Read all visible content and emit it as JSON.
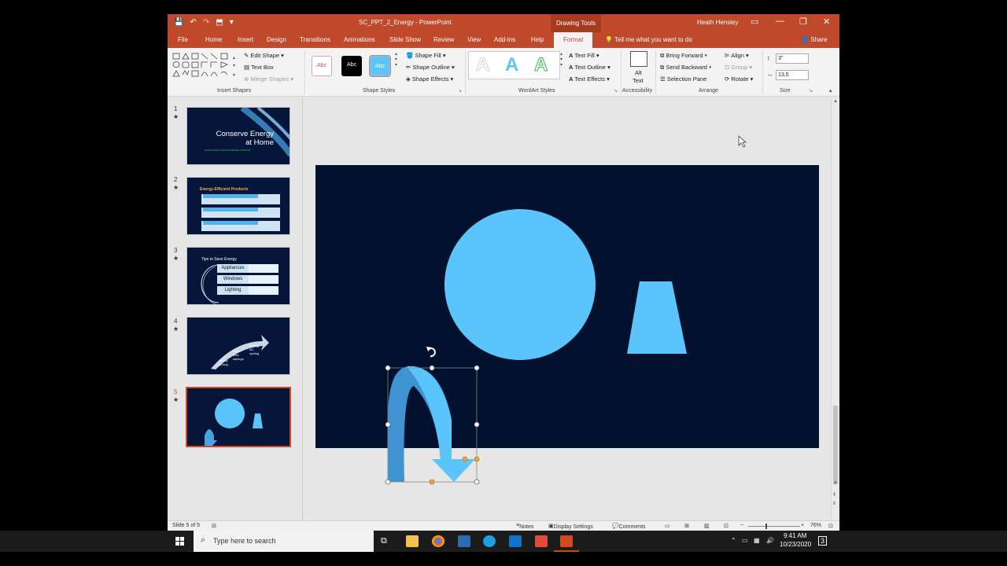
{
  "titlebar": {
    "doc_title": "SC_PPT_2_Energy  -  PowerPoint",
    "context_tab": "Drawing Tools",
    "user": "Heath Hensley",
    "qat": [
      "💾",
      "↶",
      "↷",
      "⬒",
      "▾"
    ],
    "window_buttons": [
      "▭",
      "—",
      "❐",
      "✕"
    ]
  },
  "tabs": {
    "items": [
      "File",
      "Home",
      "Insert",
      "Design",
      "Transitions",
      "Animations",
      "Slide Show",
      "Review",
      "View",
      "Add-ins",
      "Help"
    ],
    "active": "Format",
    "tell_me": "Tell me what you want to do",
    "share": "Share"
  },
  "ribbon": {
    "insert_shapes": {
      "label": "Insert Shapes",
      "edit_shape": "Edit Shape",
      "text_box": "Text Box",
      "merge_shapes": "Merge Shapes"
    },
    "shape_styles": {
      "label": "Shape Styles",
      "swatch_text": "Abc",
      "fill": "Shape Fill",
      "outline": "Shape Outline",
      "effects": "Shape Effects"
    },
    "wordart": {
      "label": "WordArt Styles",
      "letter": "A",
      "text_fill": "Text Fill",
      "text_outline": "Text Outline",
      "text_effects": "Text Effects"
    },
    "accessibility": {
      "label": "Accessibility",
      "alt_text_1": "Alt",
      "alt_text_2": "Text"
    },
    "arrange": {
      "label": "Arrange",
      "bring_forward": "Bring Forward",
      "send_backward": "Send Backward",
      "selection_pane": "Selection Pane",
      "align": "Align",
      "group": "Group",
      "rotate": "Rotate"
    },
    "size": {
      "label": "Size",
      "height": "3\"",
      "width": "13.5"
    }
  },
  "slides": {
    "numbers": [
      "1",
      "2",
      "3",
      "4",
      "5"
    ],
    "star": "★",
    "s1_title_1": "Conserve Energy",
    "s1_title_2": "at Home",
    "s1_subtitle": "SAVE MONEY AND INCREASE COMFORT",
    "s2_title": "Energy-Efficient Products",
    "s3_title": "Tips to Save Energy",
    "s3_items": [
      "Appliances",
      "Windows",
      "Lighting"
    ],
    "s4_labels": [
      "Hourly pricing",
      "Peak time savings",
      "Energy AC cycling"
    ]
  },
  "status": {
    "slide_info": "Slide 5 of 5",
    "notes": "Notes",
    "display": "Display Settings",
    "comments": "Comments",
    "zoom": "76%"
  },
  "taskbar": {
    "search_placeholder": "Type here to search",
    "time": "9:41 AM",
    "date": "10/23/2020",
    "notification_count": "3"
  }
}
